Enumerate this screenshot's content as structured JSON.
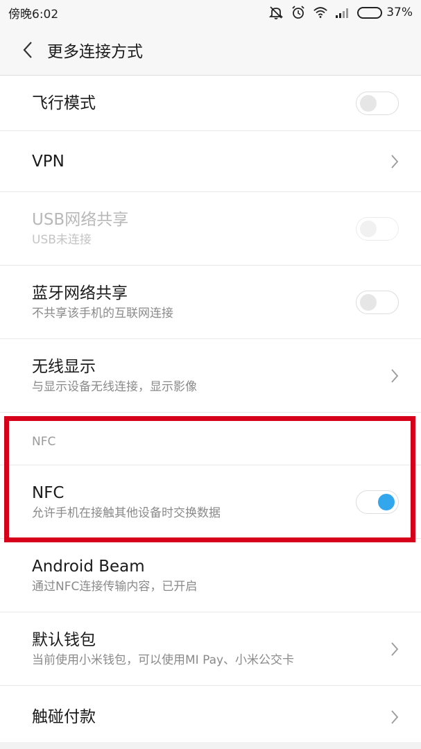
{
  "status_bar": {
    "time": "傍晚6:02",
    "battery_text": "37%",
    "battery_level": 0.37,
    "icons": [
      "mute-icon",
      "alarm-icon",
      "wifi-icon",
      "signal-icon",
      "battery-icon"
    ]
  },
  "header": {
    "title": "更多连接方式"
  },
  "items": {
    "airplane": {
      "title": "飞行模式",
      "toggle": "off"
    },
    "vpn": {
      "title": "VPN"
    },
    "usb_tether": {
      "title": "USB网络共享",
      "subtitle": "USB未连接",
      "toggle": "off",
      "state": "disabled"
    },
    "bt_tether": {
      "title": "蓝牙网络共享",
      "subtitle": "不共享该手机的互联网连接",
      "toggle": "off"
    },
    "wireless_display": {
      "title": "无线显示",
      "subtitle": "与显示设备无线连接，显示影像"
    },
    "nfc_section": {
      "label": "NFC"
    },
    "nfc": {
      "title": "NFC",
      "subtitle": "允许手机在接触其他设备时交换数据",
      "toggle": "on"
    },
    "android_beam": {
      "title": "Android Beam",
      "subtitle": "通过NFC连接传输内容，已开启"
    },
    "default_wallet": {
      "title": "默认钱包",
      "subtitle": "当前使用小米钱包，可以使用MI Pay、小米公交卡"
    },
    "tap_pay": {
      "title": "触碰付款"
    }
  },
  "colors": {
    "accent": "#33a7ee",
    "highlight": "#d7001a"
  }
}
